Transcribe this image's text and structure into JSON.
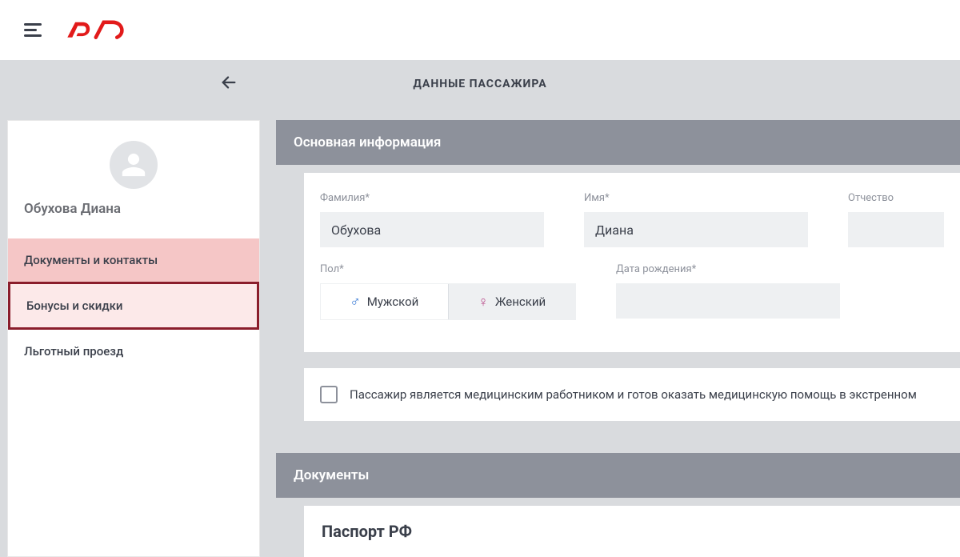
{
  "header": {
    "title": "ДАННЫЕ ПАССАЖИРА"
  },
  "sidebar": {
    "passengerName": "Обухова Диана",
    "items": [
      {
        "label": "Документы и контакты"
      },
      {
        "label": "Бонусы и скидки"
      },
      {
        "label": "Льготный проезд"
      }
    ]
  },
  "mainInfo": {
    "sectionTitle": "Основная информация",
    "lastNameLabel": "Фамилия*",
    "lastNameValue": "Обухова",
    "firstNameLabel": "Имя*",
    "firstNameValue": "Диана",
    "middleNameLabel": "Отчество",
    "middleNameValue": "",
    "genderLabel": "Пол*",
    "genderMale": "Мужской",
    "genderFemale": "Женский",
    "birthDateLabel": "Дата рождения*",
    "birthDateValue": "",
    "medCheckboxLabel": "Пассажир является медицинским работником и готов оказать медицинскую помощь в экстренном"
  },
  "documents": {
    "sectionTitle": "Документы",
    "passportTitle": "Паспорт РФ"
  }
}
